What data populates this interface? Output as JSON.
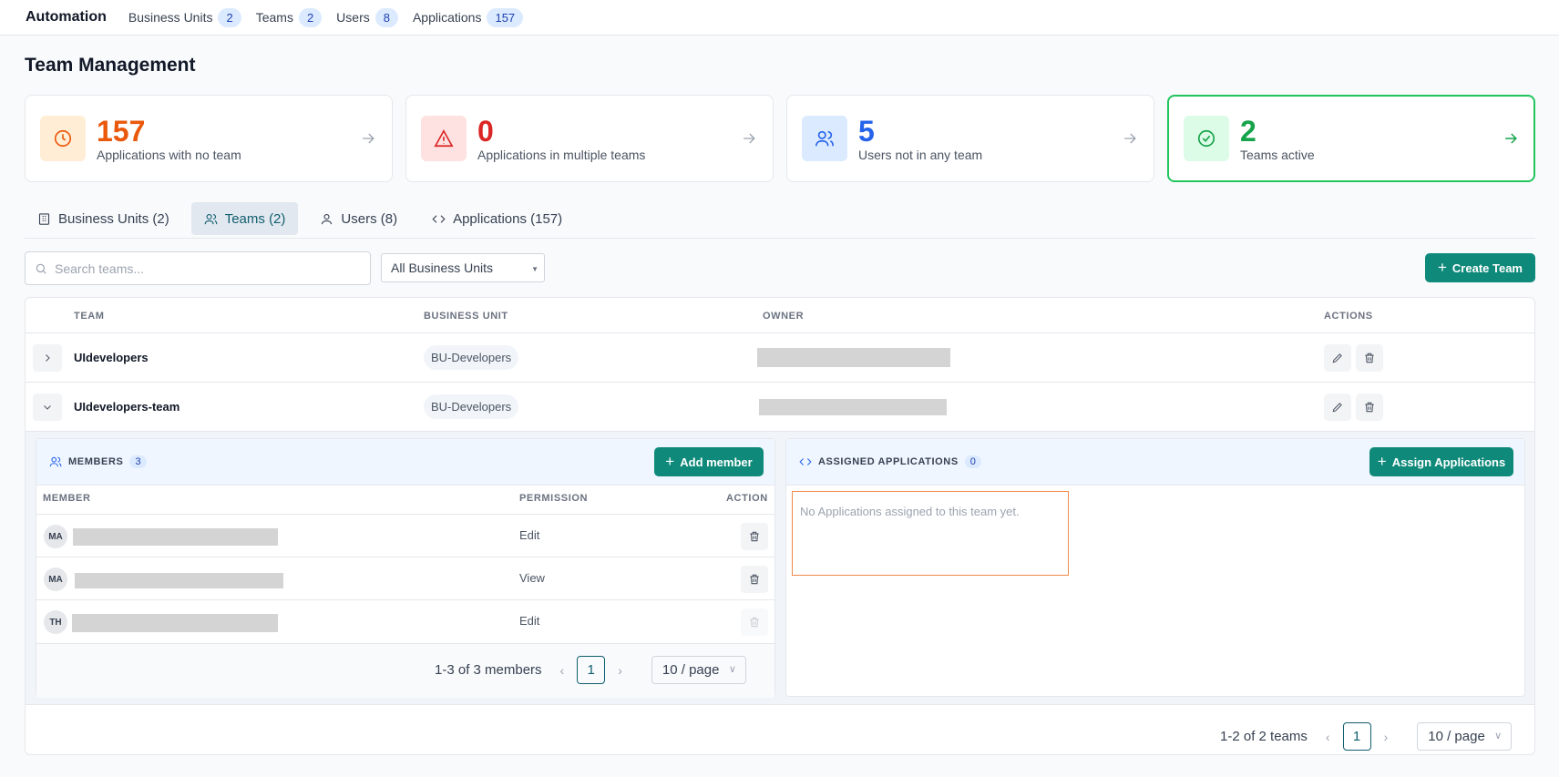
{
  "topnav": {
    "brand": "Automation",
    "items": [
      {
        "label": "Business Units",
        "count": "2"
      },
      {
        "label": "Teams",
        "count": "2"
      },
      {
        "label": "Users",
        "count": "8"
      },
      {
        "label": "Applications",
        "count": "157"
      }
    ]
  },
  "page": {
    "title": "Team Management"
  },
  "stats": [
    {
      "value": "157",
      "label": "Applications with no team",
      "color": "#ea580c",
      "icon": "clock-icon"
    },
    {
      "value": "0",
      "label": "Applications in multiple teams",
      "color": "#dc2626",
      "icon": "warning-icon"
    },
    {
      "value": "5",
      "label": "Users not in any team",
      "color": "#2563eb",
      "icon": "users-icon"
    },
    {
      "value": "2",
      "label": "Teams active",
      "color": "#16a34a",
      "icon": "check-circle-icon"
    }
  ],
  "tabs": [
    {
      "label": "Business Units (2)",
      "icon": "building-icon"
    },
    {
      "label": "Teams (2)",
      "icon": "users-icon"
    },
    {
      "label": "Users (8)",
      "icon": "user-icon"
    },
    {
      "label": "Applications (157)",
      "icon": "code-icon"
    }
  ],
  "toolbar": {
    "search_placeholder": "Search teams...",
    "bu_filter": "All Business Units",
    "create_label": "Create Team"
  },
  "table": {
    "headers": {
      "team": "TEAM",
      "business_unit": "BUSINESS UNIT",
      "owner": "OWNER",
      "actions": "ACTIONS"
    },
    "rows": [
      {
        "team": "UIdevelopers",
        "business_unit": "BU-Developers"
      },
      {
        "team": "UIdevelopers-team",
        "business_unit": "BU-Developers"
      }
    ]
  },
  "members": {
    "title": "MEMBERS",
    "count": "3",
    "add_label": "Add member",
    "headers": {
      "member": "MEMBER",
      "permission": "PERMISSION",
      "action": "ACTION"
    },
    "rows": [
      {
        "initials": "MA",
        "permission": "Edit"
      },
      {
        "initials": "MA",
        "permission": "View"
      },
      {
        "initials": "TH",
        "permission": "Edit"
      }
    ],
    "pager": {
      "summary": "1-3 of 3 members",
      "page": "1",
      "size": "10 / page"
    }
  },
  "apps": {
    "title": "ASSIGNED APPLICATIONS",
    "count": "0",
    "assign_label": "Assign Applications",
    "empty_text": "No Applications assigned to this team yet."
  },
  "footer_pager": {
    "summary": "1-2 of 2 teams",
    "page": "1",
    "size": "10 / page"
  },
  "colors": {
    "primary": "#0f8a7a",
    "accent": "#0f5e6e"
  }
}
